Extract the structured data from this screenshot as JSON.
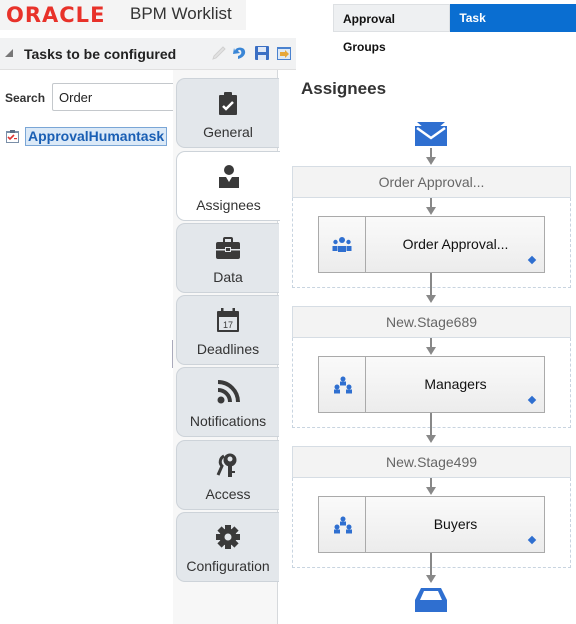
{
  "header": {
    "logo": "ORACLE",
    "logo_trademark": "®",
    "app_title": "BPM Worklist",
    "tabs": [
      {
        "label": "Approval Groups",
        "active": false
      },
      {
        "label": "Task Configuration",
        "active": true
      }
    ]
  },
  "left_pane": {
    "title": "Tasks to be configured",
    "toolbar_icons": [
      "edit-icon",
      "undo-icon",
      "save-icon",
      "commit-icon"
    ],
    "search": {
      "label": "Search",
      "value": "Order",
      "placeholder": ""
    },
    "tree_items": [
      {
        "label": "ApprovalHumantask",
        "icon": "task-icon",
        "selected": true
      }
    ]
  },
  "vertical_tabs": [
    {
      "label": "General",
      "icon": "clipboard-check-icon",
      "active": false
    },
    {
      "label": "Assignees",
      "icon": "person-icon",
      "active": true
    },
    {
      "label": "Data",
      "icon": "briefcase-icon",
      "active": false
    },
    {
      "label": "Deadlines",
      "icon": "calendar-icon",
      "active": false,
      "icon_text": "17"
    },
    {
      "label": "Notifications",
      "icon": "rss-icon",
      "active": false
    },
    {
      "label": "Access",
      "icon": "keys-icon",
      "active": false
    },
    {
      "label": "Configuration",
      "icon": "gear-icon",
      "active": false
    }
  ],
  "main": {
    "title": "Assignees",
    "colors": {
      "accent": "#2f6fd0",
      "tab_active": "#0a6ed1",
      "selection": "#1a5fb4"
    },
    "stages": [
      {
        "name": "Order Approval...",
        "participant": {
          "name": "Order Approval...",
          "icon": "group-icon"
        }
      },
      {
        "name": "New.Stage689",
        "participant": {
          "name": "Managers",
          "icon": "hierarchy-icon"
        }
      },
      {
        "name": "New.Stage499",
        "participant": {
          "name": "Buyers",
          "icon": "hierarchy-icon"
        }
      }
    ]
  }
}
